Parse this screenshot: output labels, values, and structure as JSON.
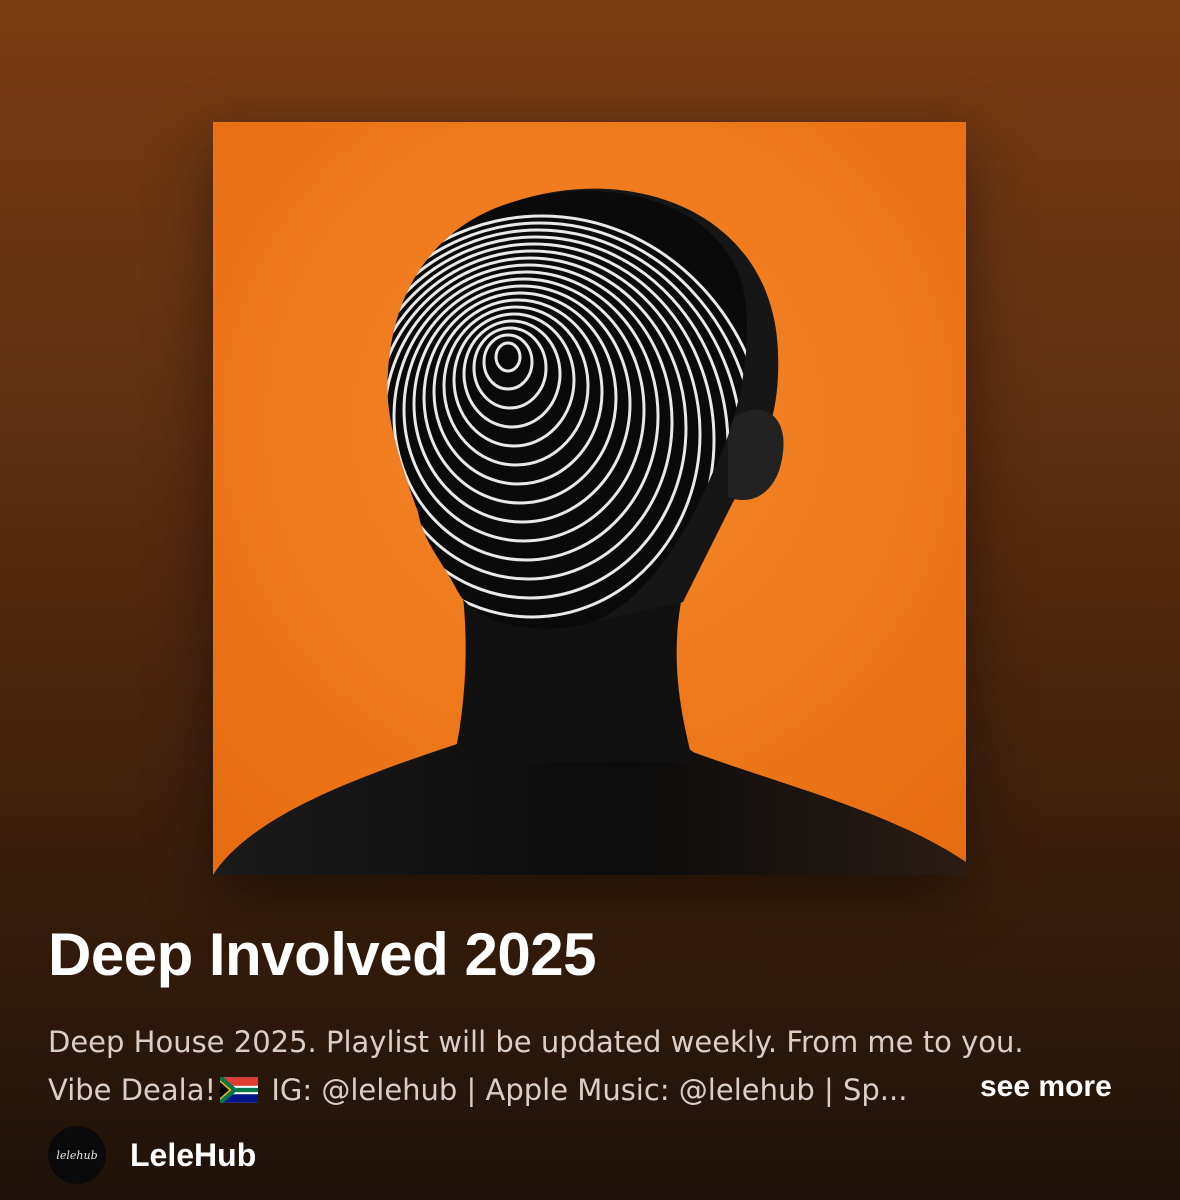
{
  "playlist": {
    "title": "Deep Involved  2025",
    "description_line1": "Deep House 2025. Playlist will be updated weekly. From me to you.",
    "description_line2_before_flag": "Vibe Deala!",
    "description_line2_after_flag": " IG: @lelehub | Apple Music: @lelehub | Sp...",
    "see_more_label": "see more",
    "cover_icon": "playlist-cover-art"
  },
  "owner": {
    "name": "LeleHub",
    "avatar_text": "lelehub"
  },
  "colors": {
    "cover_orange": "#f07a1c",
    "text_secondary": "#d9cfc8"
  }
}
